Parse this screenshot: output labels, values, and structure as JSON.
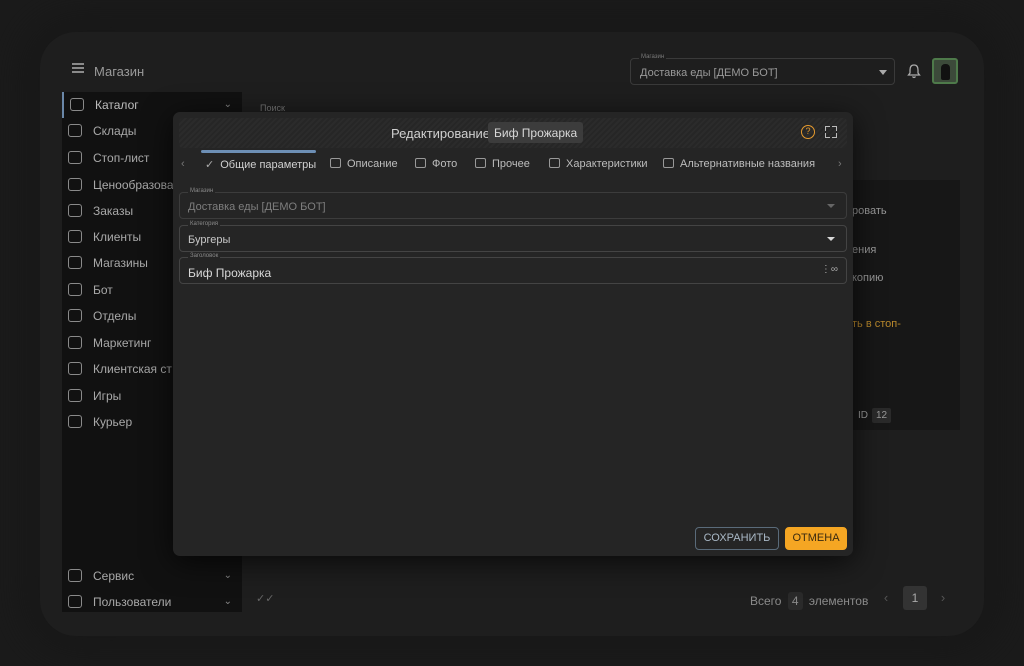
{
  "header": {
    "title": "Магазин",
    "store_label": "Магазин",
    "store_value": "Доставка еды [ДЕМО БОТ]"
  },
  "sidebar": {
    "items": [
      {
        "label": "Каталог",
        "icon": "catalog-icon"
      },
      {
        "label": "Склады",
        "icon": "warehouse-icon"
      },
      {
        "label": "Стоп-лист",
        "icon": "stop-hand-icon"
      },
      {
        "label": "Ценообразова",
        "icon": "pricing-icon"
      },
      {
        "label": "Заказы",
        "icon": "orders-icon"
      },
      {
        "label": "Клиенты",
        "icon": "clients-icon"
      },
      {
        "label": "Магазины",
        "icon": "stores-icon"
      },
      {
        "label": "Бот",
        "icon": "bot-icon"
      },
      {
        "label": "Отделы",
        "icon": "departments-icon"
      },
      {
        "label": "Маркетинг",
        "icon": "marketing-icon"
      },
      {
        "label": "Клиентская ст",
        "icon": "client-side-icon"
      },
      {
        "label": "Игры",
        "icon": "games-icon"
      },
      {
        "label": "Курьер",
        "icon": "courier-icon"
      }
    ],
    "bottom": [
      {
        "label": "Сервис",
        "icon": "service-icon"
      },
      {
        "label": "Пользователи",
        "icon": "users-icon"
      }
    ]
  },
  "background": {
    "search_label": "Поиск",
    "menu_items": [
      "ровать",
      "ения",
      "копию",
      "ть в стоп-"
    ],
    "id_label": "ID",
    "id_value": "12",
    "total_label": "Всего",
    "total_count": "4",
    "elements_label": "элементов",
    "page": "1"
  },
  "modal": {
    "title": "Редактирование",
    "item_name": "Биф Прожарка",
    "tabs": [
      {
        "label": "Общие параметры",
        "icon": "check-icon"
      },
      {
        "label": "Описание",
        "icon": "description-icon"
      },
      {
        "label": "Фото",
        "icon": "photo-icon"
      },
      {
        "label": "Прочее",
        "icon": "other-icon"
      },
      {
        "label": "Характеристики",
        "icon": "characteristics-icon"
      },
      {
        "label": "Альтернативные названия",
        "icon": "alt-names-icon"
      }
    ],
    "fields": {
      "store_label": "Магазин",
      "store_value": "Доставка еды [ДЕМО БОТ]",
      "category_label": "Категория",
      "category_value": "Бургеры",
      "heading_label": "Заголовок",
      "heading_value": "Биф Прожарка"
    },
    "buttons": {
      "save": "СОХРАНИТЬ",
      "cancel": "ОТМЕНА"
    }
  },
  "colors": {
    "accent_orange": "#f5a623",
    "tab_indicator": "#6d8fb5"
  }
}
